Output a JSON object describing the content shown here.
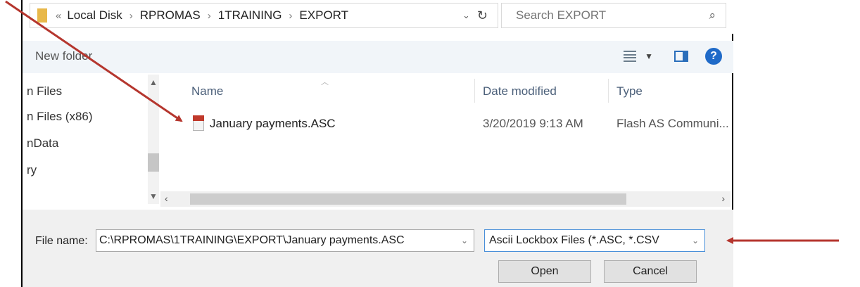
{
  "address_bar": {
    "overflow_chevron": "«",
    "breadcrumbs": [
      "Local Disk",
      "RPROMAS",
      "1TRAINING",
      "EXPORT"
    ],
    "separator": "›",
    "search_placeholder": "Search EXPORT"
  },
  "toolbar": {
    "new_folder_label": "New folder"
  },
  "nav_pane": {
    "items": [
      "n Files",
      "n Files (x86)",
      "nData",
      "ry"
    ]
  },
  "file_list": {
    "columns": [
      "Name",
      "Date modified",
      "Type"
    ],
    "rows": [
      {
        "name": "January payments.ASC",
        "date_modified": "3/20/2019 9:13 AM",
        "type": "Flash AS Communi..."
      }
    ]
  },
  "bottom_panel": {
    "file_name_label": "File name:",
    "file_name_value": "C:\\RPROMAS\\1TRAINING\\EXPORT\\January payments.ASC",
    "file_type_value": "Ascii Lockbox Files (*.ASC, *.CSV",
    "open_label": "Open",
    "cancel_label": "Cancel"
  },
  "colors": {
    "annotation_arrow": "#b5362e",
    "help_icon": "#1f6ac8",
    "active_border": "#4a90d9"
  },
  "icons": [
    "folder-icon",
    "refresh-icon",
    "search-icon",
    "view-options-icon",
    "preview-pane-icon",
    "help-icon",
    "asc-file-icon",
    "dropdown-arrow-icon"
  ]
}
